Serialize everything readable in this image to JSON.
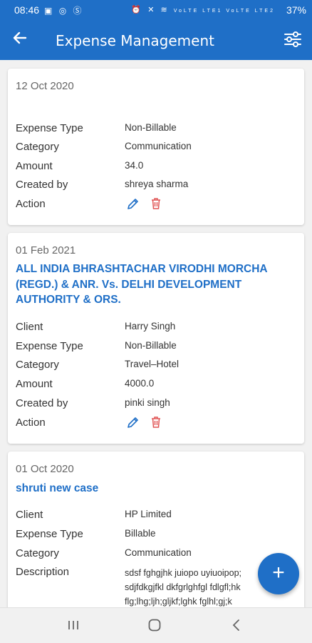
{
  "status_bar": {
    "time": "08:46",
    "left_icons": [
      "gallery-icon",
      "whatsapp-icon",
      "skype-icon"
    ],
    "right_icons_text": "VoLTE LTE1 VoLTE LTE2",
    "battery": "37%"
  },
  "app_bar": {
    "title": "Expense Management",
    "back_icon": "arrow-back-icon",
    "filter_icon": "filter-sliders-icon"
  },
  "colors": {
    "primary": "#1f6fc7",
    "edit": "#1f6fc7",
    "delete": "#e05555"
  },
  "labels": {
    "client": "Client",
    "expense_type": "Expense Type",
    "category": "Category",
    "amount": "Amount",
    "created_by": "Created by",
    "action": "Action",
    "description": "Description"
  },
  "expenses": [
    {
      "date": "12 Oct 2020",
      "case_title": "",
      "expense_type": "Non-Billable",
      "category": "Communication",
      "amount": "34.0",
      "created_by": "shreya sharma"
    },
    {
      "date": "01 Feb 2021",
      "case_title": "ALL INDIA BHRASHTACHAR VIRODHI MORCHA (REGD.) & ANR.  Vs. DELHI DEVELOPMENT AUTHORITY & ORS.",
      "client": "Harry Singh",
      "expense_type": "Non-Billable",
      "category": "Travel–Hotel",
      "amount": "4000.0",
      "created_by": "pinki singh"
    },
    {
      "date": "01 Oct 2020",
      "case_title": "shruti new case",
      "client": "HP Limited",
      "expense_type": "Billable",
      "category": "Communication",
      "description_lines": [
        "sdsf fghgjhk juiopo uyiuoipop;",
        "sdjfdkgjfkl dkfgrlghfgl fdlgfl;hk",
        "flg;lhg;ljh;gljkf;lghk fglhl;gj;k"
      ]
    }
  ],
  "fab": {
    "label": "+",
    "icon": "add-icon"
  },
  "nav_bar": {
    "icons": [
      "recents-icon",
      "home-icon",
      "back-icon"
    ]
  }
}
